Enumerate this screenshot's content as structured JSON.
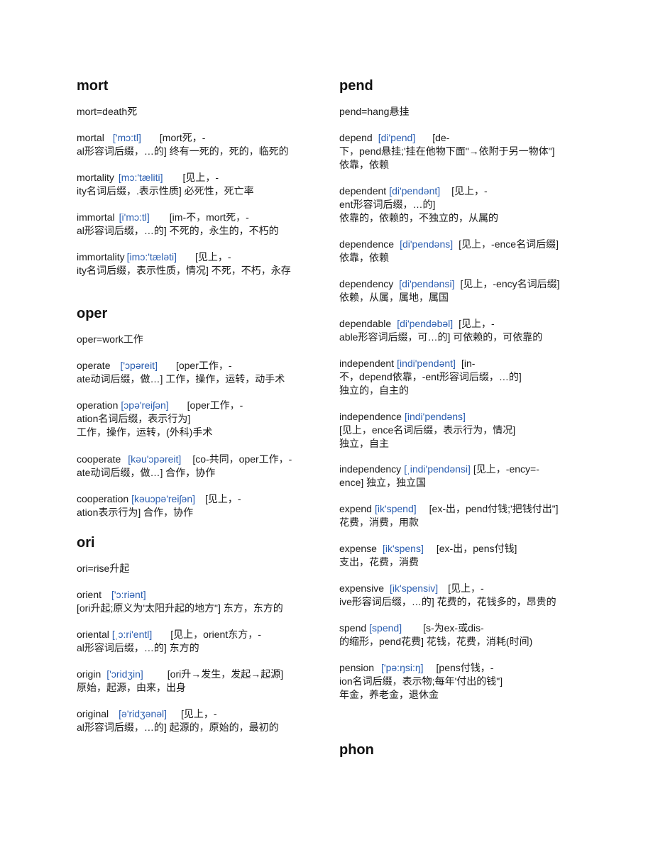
{
  "colors": {
    "phonetic": "#2a5db0",
    "text": "#1a1a1a",
    "heading": "#111111"
  },
  "left": {
    "mort": {
      "heading": "mort",
      "root": "mort=death死",
      "entries": [
        {
          "word": "mortal",
          "phonetic": "['mɔ:tl]",
          "etym1": "[mort死，-",
          "etym2": "al形容词后缀，…的] 终有一死的，死的，临死的"
        },
        {
          "word": "mortality",
          "phonetic": "[mɔ:'tæliti]",
          "etym1": "[见上，-",
          "etym2": "ity名词后缀，.表示性质] 必死性，死亡率"
        },
        {
          "word": "immortal",
          "phonetic": "[i'mɔ:tl]",
          "etym1": "[im-不，mort死，-",
          "etym2": "al形容词后缀，…的] 不死的，永生的，不朽的"
        },
        {
          "word": "immortality",
          "phonetic": "[imɔ:'tæləti]",
          "etym1": "[见上，-",
          "etym2": "ity名词后缀，表示性质，情况] 不死，不朽，永存"
        }
      ]
    },
    "oper": {
      "heading": "oper",
      "root": "oper=work工作",
      "entries": [
        {
          "word": "operate",
          "phonetic": "['ɔpəreit]",
          "etym1": "[oper工作，-",
          "etym2": "ate动词后缀，做…] 工作，操作，运转，动手术"
        },
        {
          "word": "operation",
          "phonetic": "[ɔpə'reiʃən]",
          "etym1": "[oper工作，-",
          "etym2": "ation名词后缀，表示行为]",
          "etym3": "工作，操作，运转，(外科)手术"
        },
        {
          "word": "cooperate",
          "phonetic": "[kəu'ɔpəreit]",
          "etym1": "[co-共同，oper工作，-",
          "etym2": "ate动词后缀，做…] 合作，协作"
        },
        {
          "word": "cooperation",
          "phonetic": "[kəuɔpə'reiʃən]",
          "etym1": "[见上，-",
          "etym2": "ation表示行为] 合作，协作"
        }
      ]
    },
    "ori": {
      "heading": "ori",
      "root": "ori=rise升起",
      "entries": [
        {
          "word": "orient",
          "phonetic": "['ɔ:riənt]",
          "etym1": "",
          "etym2": "[ori升起;原义为'太阳升起的地方\"] 东方，东方的"
        },
        {
          "word": "oriental",
          "phonetic": "[ˌɔ:ri'entl]",
          "etym1": "[见上，orient东方，-",
          "etym2": "al形容词后缀，…的] 东方的"
        },
        {
          "word": "origin",
          "phonetic": "['ɔridʒin]",
          "etym1": "[ori升→发生，发起→起源]",
          "etym2": "原始，起源，由来，出身"
        },
        {
          "word": "original",
          "phonetic": "[ə'ridʒənəl]",
          "etym1": "[见上，-",
          "etym2": "al形容词后缀，…的] 起源的，原始的，最初的"
        }
      ]
    }
  },
  "right": {
    "pend": {
      "heading": "pend",
      "root": "pend=hang悬挂",
      "entries": [
        {
          "word": "depend",
          "phonetic": "[di'pend]",
          "etym1": "[de-",
          "etym2": "下，pend悬挂;'挂在他物下面\"→依附于另一物体\"]",
          "etym3": "依靠，依赖"
        },
        {
          "word": "dependent",
          "phonetic": "[di'pendənt]",
          "etym1": "[见上，-",
          "etym2": "ent形容词后缀，…的]",
          "etym3": "依靠的，依赖的，不独立的，从属的"
        },
        {
          "word": "dependence",
          "phonetic": "[di'pendəns]",
          "etym1": "[见上，-ence名词后缀]",
          "etym2": "依靠，依赖"
        },
        {
          "word": "dependency",
          "phonetic": "[di'pendənsi]",
          "etym1": "[见上，-ency名词后缀]",
          "etym2": "依赖，从属，属地，属国"
        },
        {
          "word": "dependable",
          "phonetic": "[di'pendəbəl]",
          "etym1": "[见上，-",
          "etym2": "able形容词后缀，可…的] 可依赖的，可依靠的"
        },
        {
          "word": "independent",
          "phonetic": "[indi'pendənt]",
          "etym1": "[in-",
          "etym2": "不，depend依靠，-ent形容词后缀，…的]",
          "etym3": "独立的，自主的"
        },
        {
          "word": "independence",
          "phonetic": "[indi'pendəns]",
          "etym1": "",
          "etym2": "[见上，ence名词后缀，表示行为，情况]",
          "etym3": "独立，自主"
        },
        {
          "word": "independency",
          "phonetic": "[ˌindi'pendənsi]",
          "etym1": "[见上，-ency=-",
          "etym2": "ence] 独立，独立国"
        },
        {
          "word": "expend",
          "phonetic": "[ik'spend]",
          "etym1": "[ex-出，pend付钱;'把钱付出\"]",
          "etym2": "花费，消费，用款"
        },
        {
          "word": "expense",
          "phonetic": "[ik'spens]",
          "etym1": "[ex-出，pens付钱]",
          "etym2": "支出，花费，消费"
        },
        {
          "word": "expensive",
          "phonetic": "[ik'spensiv]",
          "etym1": "[见上，-",
          "etym2": "ive形容词后缀，…的] 花费的，花钱多的，昂贵的"
        },
        {
          "word": "spend",
          "phonetic": "[spend]",
          "etym1": "[s-为ex-或dis-",
          "etym2": "的缩形，pend花费] 花钱，花费，消耗(时间)"
        },
        {
          "word": "pension",
          "phonetic": "['pə:ŋsi:ŋ]",
          "etym1": "[pens付钱，-",
          "etym2": "ion名词后缀，表示物;每年'付出的钱\"]",
          "etym3": "年金，养老金，退休金"
        }
      ]
    },
    "phon": {
      "heading": "phon"
    }
  }
}
